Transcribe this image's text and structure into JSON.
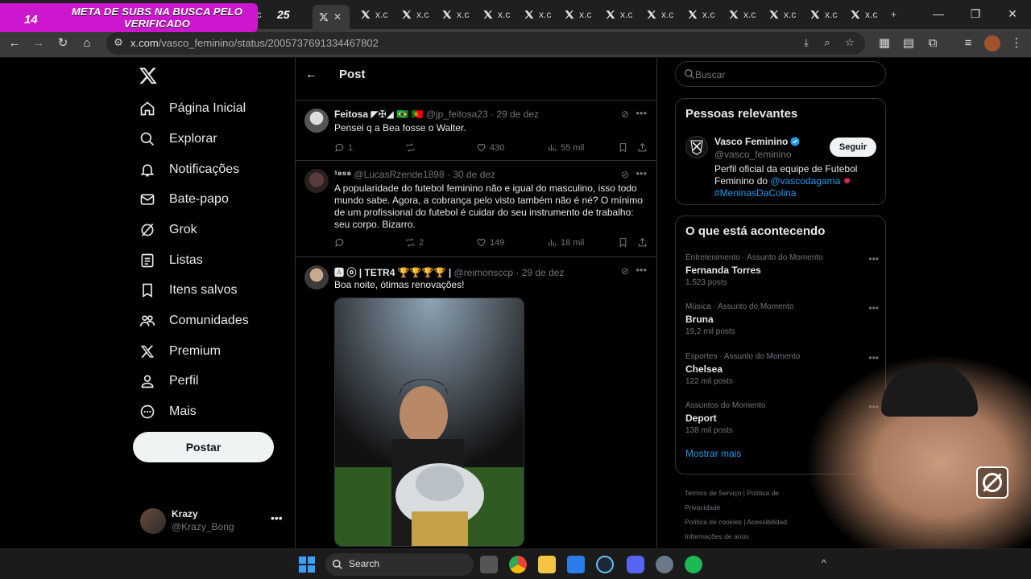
{
  "overlay": {
    "count": "14",
    "text": "META DE SUBS NA BUSCA PELO VERIFICADO"
  },
  "browser": {
    "tab_counter": "25",
    "tab_label": "x.c",
    "tab_partial_label": "A c",
    "active_tab_icon": "x-icon",
    "url_domain": "x.com",
    "url_path": "/vasco_feminino/status/2005737691334467802"
  },
  "sidebar": {
    "items": [
      {
        "label": "Página Inicial",
        "icon": "home-icon"
      },
      {
        "label": "Explorar",
        "icon": "search-icon"
      },
      {
        "label": "Notificações",
        "icon": "bell-icon"
      },
      {
        "label": "Bate-papo",
        "icon": "mail-icon"
      },
      {
        "label": "Grok",
        "icon": "grok-icon"
      },
      {
        "label": "Listas",
        "icon": "list-icon"
      },
      {
        "label": "Itens salvos",
        "icon": "bookmark-icon"
      },
      {
        "label": "Comunidades",
        "icon": "people-icon"
      },
      {
        "label": "Premium",
        "icon": "x-icon"
      },
      {
        "label": "Perfil",
        "icon": "person-icon"
      },
      {
        "label": "Mais",
        "icon": "more-circle-icon"
      }
    ],
    "post_label": "Postar",
    "account": {
      "name": "Krazy",
      "handle": "@Krazy_Bong"
    }
  },
  "center": {
    "title": "Post",
    "tweets": [
      {
        "name": "Feitosa",
        "handle": "@jp_feitosa23",
        "date": "29 de dez",
        "text": "Pensei q a Bea fosse o Walter.",
        "replies": "1",
        "retweets": "",
        "likes": "430",
        "views": "55 mil"
      },
      {
        "name": "¹⁸⁹⁸",
        "handle": "@LucasRzende1898",
        "date": "30 de dez",
        "text": "A popularidade do futebol feminino não e igual do masculino, isso todo mundo sabe. Agora, a cobrança pelo visto também não é né? O mínimo de um profissional do futebol é cuidar do seu instrumento de trabalho: seu corpo. Bizarro.",
        "replies": "",
        "retweets": "2",
        "likes": "149",
        "views": "18 mil"
      },
      {
        "name": "| TETR4 🏆🏆🏆🏆 |",
        "handle": "@reimonsccp",
        "date": "29 de dez",
        "text": "Boa noite, ótimas renovações!"
      }
    ]
  },
  "right": {
    "search_placeholder": "Buscar",
    "relevant_title": "Pessoas relevantes",
    "relevant": {
      "name": "Vasco Feminino",
      "handle": "@vasco_feminino",
      "follow_label": "Seguir",
      "bio_text": "Perfil oficial da equipe de Futebol Feminino do ",
      "bio_link": "@vascodagama",
      "bio_tag": "#MeninasDaColina"
    },
    "trends_title": "O que está acontecendo",
    "trends": [
      {
        "category": "Entretenimento · Assunto do Momento",
        "title": "Fernanda Torres",
        "posts": "1.523 posts"
      },
      {
        "category": "Música · Assunto do Momento",
        "title": "Bruna",
        "posts": "19,2 mil posts"
      },
      {
        "category": "Esportes · Assunto do Momento",
        "title": "Chelsea",
        "posts": "122 mil posts"
      },
      {
        "category": "Assuntos do Momento",
        "title": "Deport",
        "posts": "138 mil posts"
      }
    ],
    "show_more": "Mostrar mais",
    "footer": {
      "terms": "Termos de Serviço",
      "privacy": "Política de Privacidade",
      "cookies": "Política de cookies",
      "accessibility": "Acessibilidad",
      "ads": "Informações de anún"
    }
  },
  "taskbar": {
    "search_label": "Search"
  },
  "colors": {
    "accent": "#1d9bf0",
    "overlay": "#cc17cf",
    "background": "#000000",
    "border": "#2f3336"
  }
}
